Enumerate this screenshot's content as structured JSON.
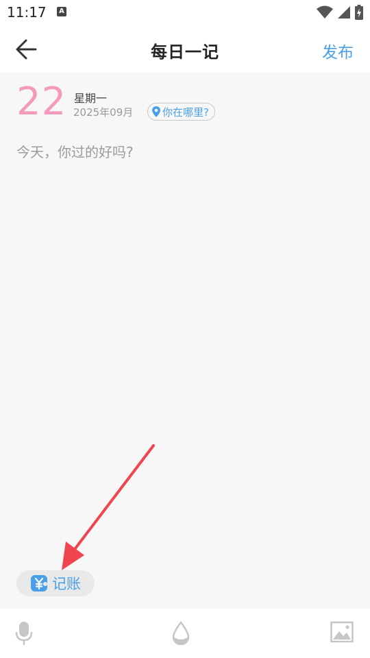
{
  "status_bar": {
    "time": "11:17",
    "notification_letter": "A"
  },
  "app_bar": {
    "title": "每日一记",
    "publish_label": "发布"
  },
  "entry": {
    "day": "22",
    "weekday": "星期一",
    "year_month": "2025年09月",
    "location_label": "你在哪里?",
    "placeholder": "今天，你过的好吗?"
  },
  "bookkeeping": {
    "label": "记账"
  },
  "icons": {
    "back": "arrow-left-icon",
    "location": "location-pin-icon",
    "bookkeeping": "yen-note-icon",
    "mic": "microphone-icon",
    "drop": "water-drop-icon",
    "image": "image-icon"
  },
  "colors": {
    "accent": "#4aa0e8",
    "day_pink": "#f49bbd",
    "annotation_red": "#f0444f"
  }
}
